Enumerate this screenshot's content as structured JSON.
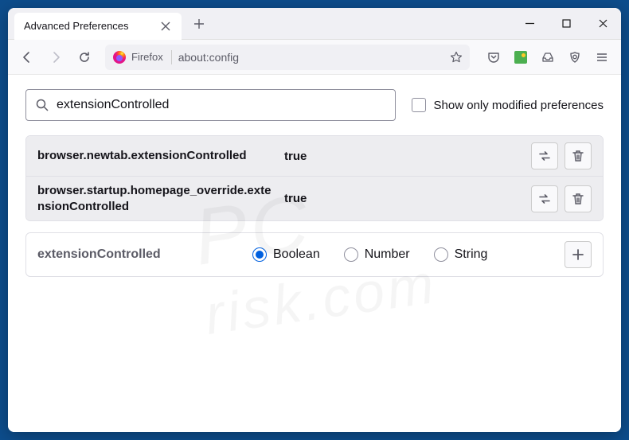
{
  "window": {
    "tab_title": "Advanced Preferences"
  },
  "toolbar": {
    "brand": "Firefox",
    "url": "about:config"
  },
  "search": {
    "value": "extensionControlled",
    "checkbox_label": "Show only modified preferences"
  },
  "prefs": [
    {
      "name": "browser.newtab.extensionControlled",
      "value": "true"
    },
    {
      "name": "browser.startup.homepage_override.extensionControlled",
      "value": "true"
    }
  ],
  "new_pref": {
    "name": "extensionControlled",
    "types": [
      "Boolean",
      "Number",
      "String"
    ],
    "selected": "Boolean"
  },
  "watermark": {
    "line1": "PC",
    "line2": "risk.com"
  }
}
